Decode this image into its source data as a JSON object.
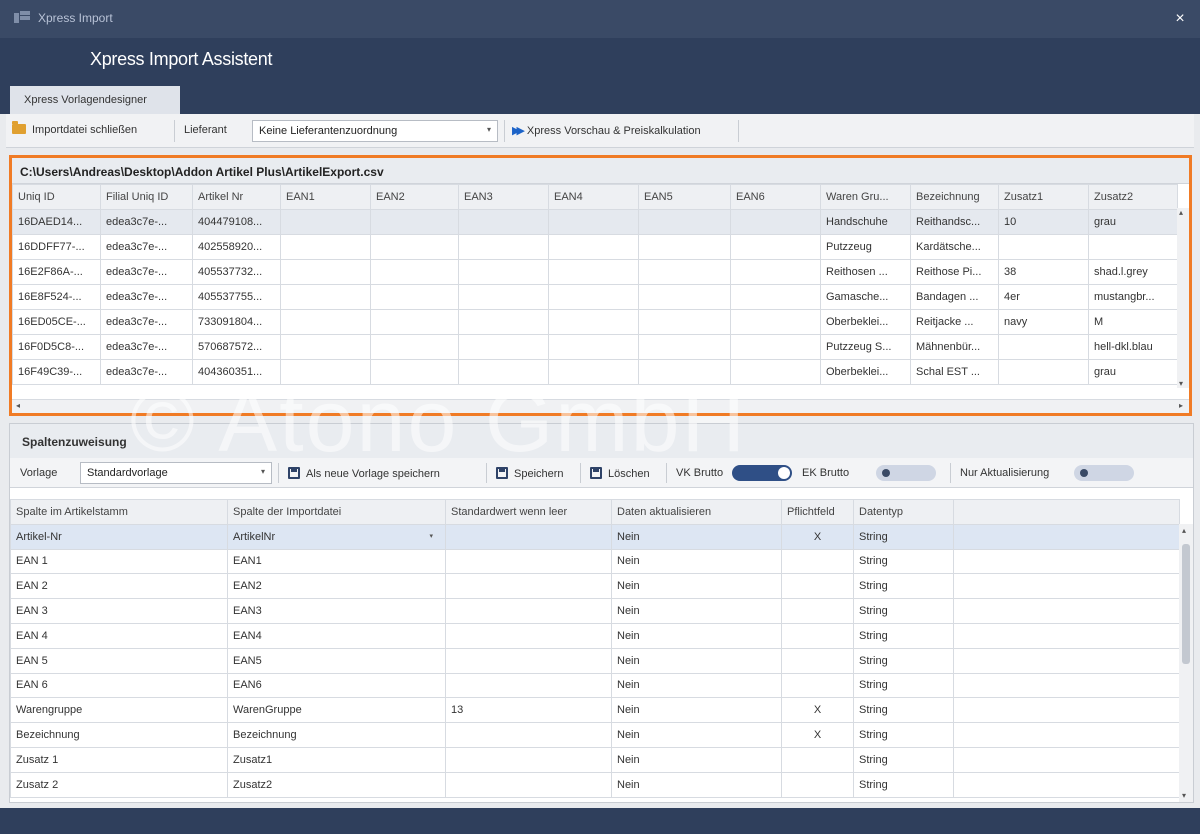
{
  "window": {
    "title": "Xpress Import",
    "close_glyph": "×",
    "header_title": "Xpress Import Assistent"
  },
  "tab": {
    "label": "Xpress Vorlagendesigner"
  },
  "toolbar": {
    "close_file": "Importdatei schließen",
    "supplier_label": "Lieferant",
    "supplier_value": "Keine Lieferantenzuordnung",
    "preview": "Xpress Vorschau & Preiskalkulation"
  },
  "preview": {
    "file_path": "C:\\Users\\Andreas\\Desktop\\Addon Artikel Plus\\ArtikelExport.csv",
    "columns": [
      "Uniq ID",
      "Filial Uniq ID",
      "Artikel Nr",
      "EAN1",
      "EAN2",
      "EAN3",
      "EAN4",
      "EAN5",
      "EAN6",
      "Waren Gru...",
      "Bezeichnung",
      "Zusatz1",
      "Zusatz2"
    ],
    "rows": [
      [
        "16DAED14...",
        "edea3c7e-...",
        "404479108...",
        "",
        "",
        "",
        "",
        "",
        "",
        "Handschuhe",
        "Reithandsc...",
        "10",
        "grau"
      ],
      [
        "16DDFF77-...",
        "edea3c7e-...",
        "402558920...",
        "",
        "",
        "",
        "",
        "",
        "",
        "Putzzeug",
        "Kardätsche...",
        "",
        ""
      ],
      [
        "16E2F86A-...",
        "edea3c7e-...",
        "405537732...",
        "",
        "",
        "",
        "",
        "",
        "",
        "Reithosen ...",
        "Reithose Pi...",
        "38",
        "shad.l.grey"
      ],
      [
        "16E8F524-...",
        "edea3c7e-...",
        "405537755...",
        "",
        "",
        "",
        "",
        "",
        "",
        "Gamasche...",
        "Bandagen ...",
        "4er",
        "mustangbr..."
      ],
      [
        "16ED05CE-...",
        "edea3c7e-...",
        "733091804...",
        "",
        "",
        "",
        "",
        "",
        "",
        "Oberbeklei...",
        "Reitjacke ...",
        "navy",
        "M"
      ],
      [
        "16F0D5C8-...",
        "edea3c7e-...",
        "570687572...",
        "",
        "",
        "",
        "",
        "",
        "",
        "Putzzeug S...",
        "Mähnenbür...",
        "",
        "hell-dkl.blau"
      ],
      [
        "16F49C39-...",
        "edea3c7e-...",
        "404360351...",
        "",
        "",
        "",
        "",
        "",
        "",
        "Oberbeklei...",
        "Schal EST ...",
        "",
        "grau"
      ]
    ],
    "scroll_left": "◂",
    "scroll_right": "▸",
    "scroll_up": "▴",
    "scroll_down": "▾"
  },
  "watermark": "© Atono GmbH",
  "assignment": {
    "title": "Spaltenzuweisung",
    "template_label": "Vorlage",
    "template_value": "Standardvorlage",
    "save_as_new": "Als neue Vorlage speichern",
    "save": "Speichern",
    "delete": "Löschen",
    "vk_brutto": "VK Brutto",
    "vk_brutto_on": true,
    "ek_brutto": "EK Brutto",
    "ek_brutto_on": false,
    "update_only": "Nur Aktualisierung",
    "update_only_on": false,
    "columns": [
      "Spalte im Artikelstamm",
      "Spalte der Importdatei",
      "Standardwert wenn leer",
      "Daten aktualisieren",
      "Pflichtfeld",
      "Datentyp",
      ""
    ],
    "rows": [
      [
        "Artikel-Nr",
        "ArtikelNr",
        "",
        "Nein",
        "X",
        "String"
      ],
      [
        "EAN 1",
        "EAN1",
        "",
        "Nein",
        "",
        "String"
      ],
      [
        "EAN 2",
        "EAN2",
        "",
        "Nein",
        "",
        "String"
      ],
      [
        "EAN 3",
        "EAN3",
        "",
        "Nein",
        "",
        "String"
      ],
      [
        "EAN 4",
        "EAN4",
        "",
        "Nein",
        "",
        "String"
      ],
      [
        "EAN 5",
        "EAN5",
        "",
        "Nein",
        "",
        "String"
      ],
      [
        "EAN 6",
        "EAN6",
        "",
        "Nein",
        "",
        "String"
      ],
      [
        "Warengruppe",
        "WarenGruppe",
        "13",
        "Nein",
        "X",
        "String"
      ],
      [
        "Bezeichnung",
        "Bezeichnung",
        "",
        "Nein",
        "X",
        "String"
      ],
      [
        "Zusatz 1",
        "Zusatz1",
        "",
        "Nein",
        "",
        "String"
      ],
      [
        "Zusatz 2",
        "Zusatz2",
        "",
        "Nein",
        "",
        "String"
      ]
    ],
    "dropdown_arrow": "▾"
  },
  "colors": {
    "window_chrome": "#3a4a66",
    "header": "#2f3f5c",
    "highlight_border": "#f07b25",
    "toggle_on": "#2f4f86",
    "preview_icon": "#1c63c8"
  }
}
